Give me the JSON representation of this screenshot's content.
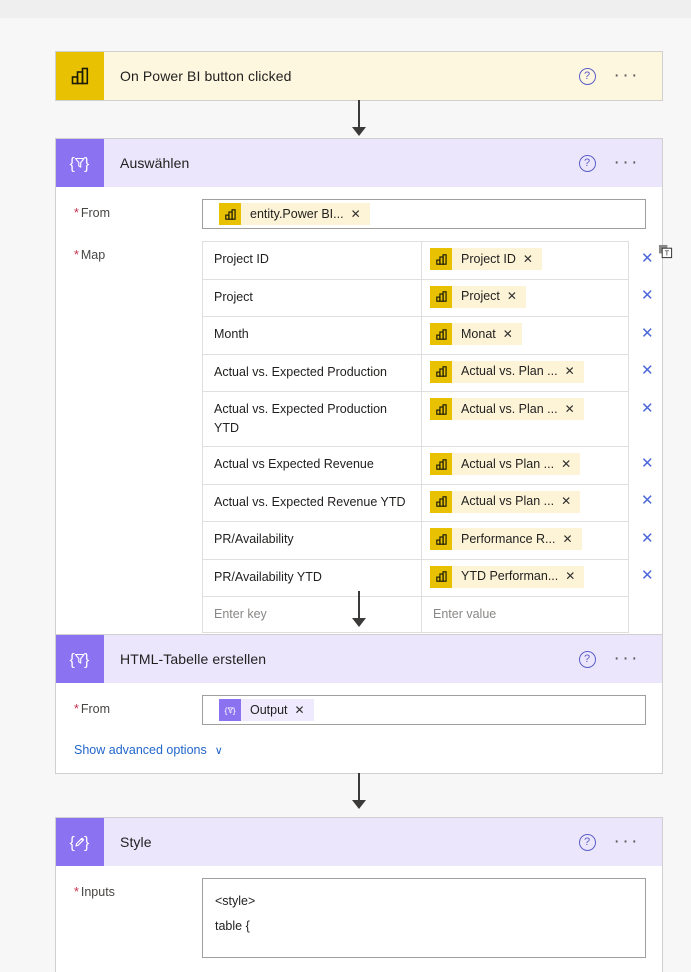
{
  "flow": {
    "trigger": {
      "title": "On Power BI button clicked",
      "icon": "power-bi-icon",
      "help_label": "?",
      "more_label": "···"
    },
    "steps": [
      {
        "title": "Auswählen",
        "icon": "select-filter-icon",
        "from_label": "From",
        "from_token": {
          "label": "entity.Power BI...",
          "icon": "power-bi-icon",
          "remove": "✕"
        },
        "map_label": "Map",
        "map_rows": [
          {
            "key": "Project ID",
            "value": "Project ID"
          },
          {
            "key": "Project",
            "value": "Project"
          },
          {
            "key": "Month",
            "value": "Monat"
          },
          {
            "key": "Actual vs. Expected Production",
            "value": "Actual vs. Plan ..."
          },
          {
            "key": "Actual vs. Expected Production YTD",
            "value": "Actual vs. Plan ..."
          },
          {
            "key": "Actual vs Expected Revenue",
            "value": "Actual vs Plan ..."
          },
          {
            "key": "Actual vs. Expected Revenue YTD",
            "value": "Actual vs Plan ..."
          },
          {
            "key": "PR/Availability",
            "value": "Performance R..."
          },
          {
            "key": "PR/Availability YTD",
            "value": "YTD Performan..."
          }
        ],
        "key_placeholder": "Enter key",
        "value_placeholder": "Enter value",
        "remove_row_label": "✕",
        "text_mode_label": "T"
      },
      {
        "title": "HTML-Tabelle erstellen",
        "icon": "select-filter-icon",
        "from_label": "From",
        "from_token": {
          "label": "Output",
          "icon": "flow-output-icon",
          "remove": "✕"
        },
        "advanced_label": "Show advanced options",
        "advanced_chevron": "∨"
      },
      {
        "title": "Style",
        "icon": "compose-pencil-icon",
        "inputs_label": "Inputs",
        "inputs_value": "<style>\ntable {"
      }
    ]
  },
  "colors": {
    "power_bi_yellow": "#e8c202",
    "flow_purple": "#8b72f0",
    "trigger_header": "#fdf7e0",
    "action_header": "#ece6fd",
    "link_blue": "#2266cc",
    "required_red": "#c4314b"
  }
}
